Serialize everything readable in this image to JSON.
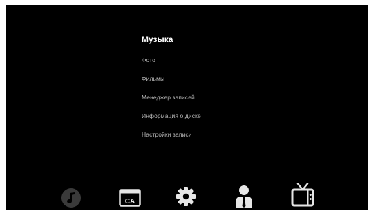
{
  "menu": {
    "items": [
      {
        "label": "Музыка",
        "selected": true
      },
      {
        "label": "Фото",
        "selected": false
      },
      {
        "label": "Фильмы",
        "selected": false
      },
      {
        "label": "Менеджер записей",
        "selected": false
      },
      {
        "label": "Информация о диске",
        "selected": false
      },
      {
        "label": "Настройки записи",
        "selected": false
      }
    ]
  },
  "iconbar": {
    "items": [
      {
        "icon": "music-note-icon"
      },
      {
        "icon": "ca-card-icon",
        "text": "CA"
      },
      {
        "icon": "gear-icon"
      },
      {
        "icon": "user-icon"
      },
      {
        "icon": "tv-icon"
      }
    ]
  },
  "colors": {
    "background": "#000000",
    "menu_selected": "#ffffff",
    "menu_normal": "#b8b8b8",
    "icon_active": "#3a3a3a",
    "icon_normal": "#e6e6e6"
  }
}
